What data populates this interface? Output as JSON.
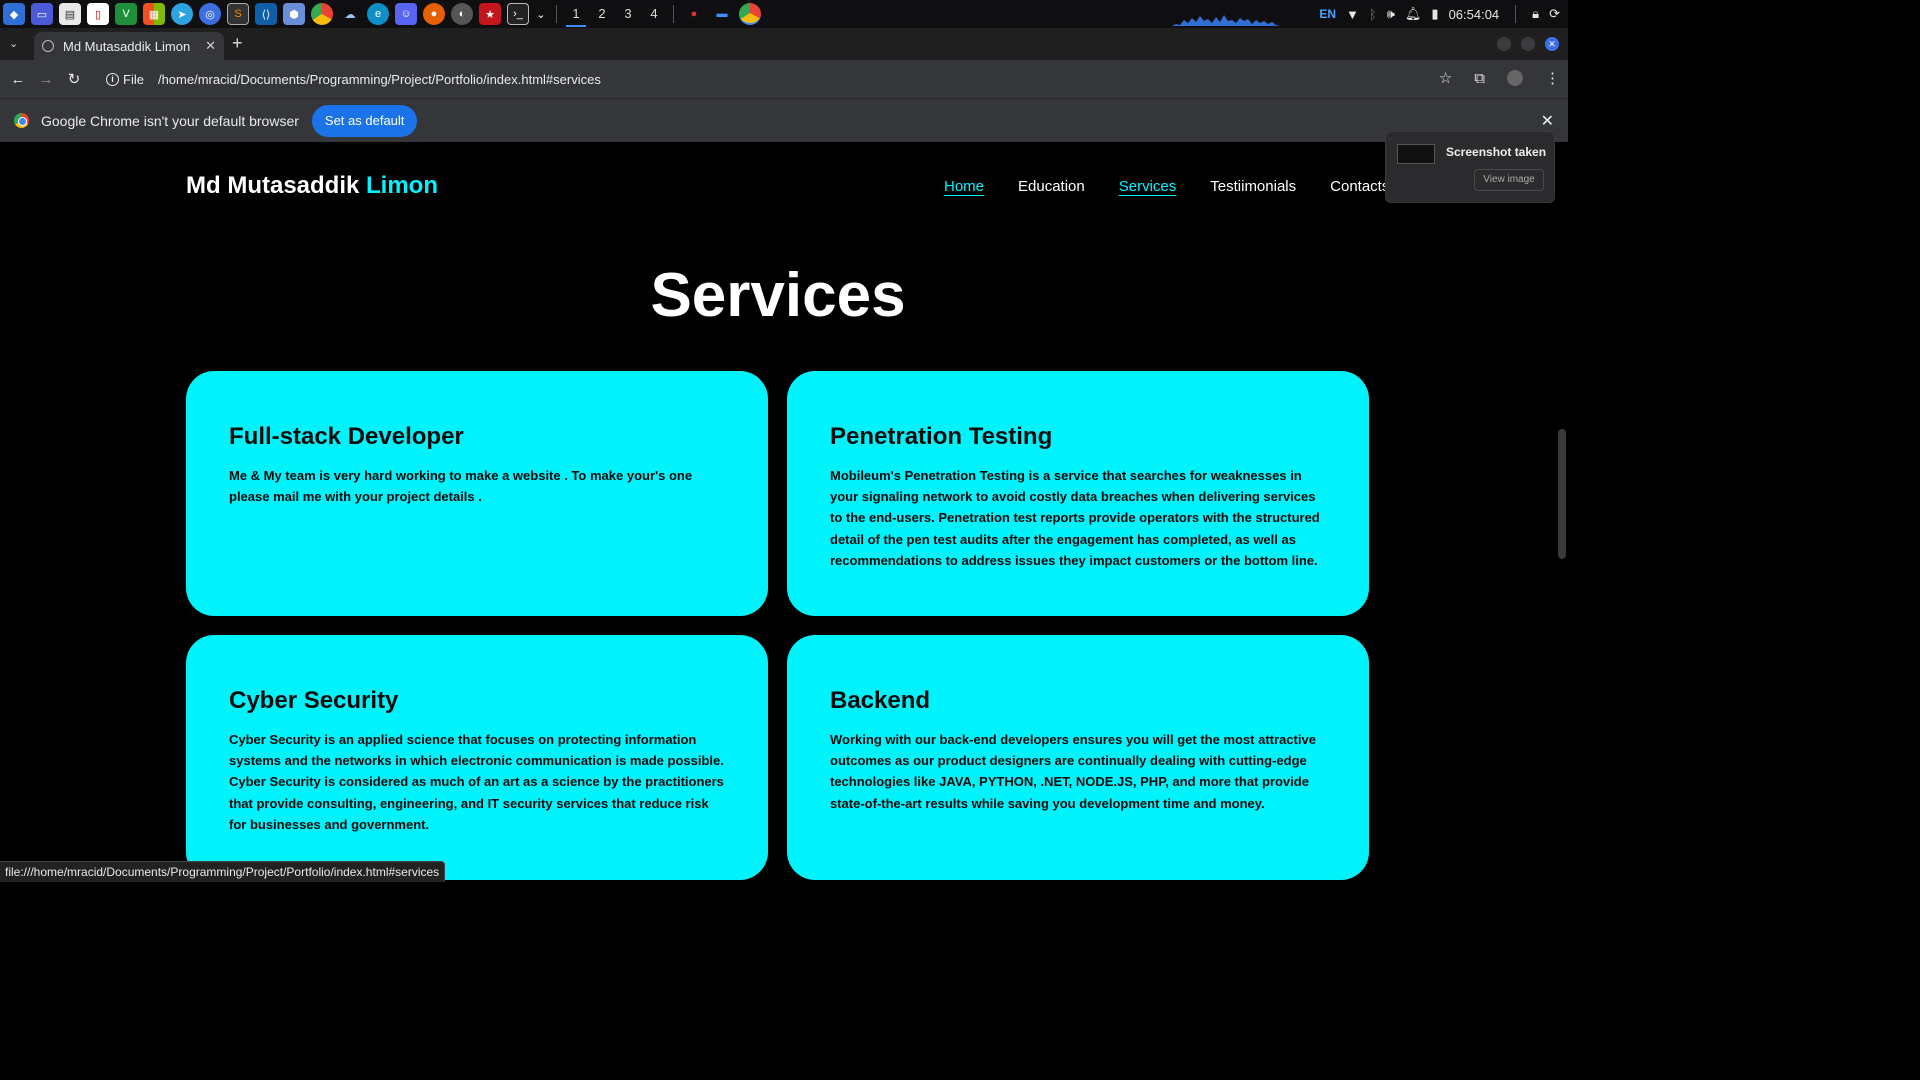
{
  "taskbar": {
    "workspaces": [
      "1",
      "2",
      "3",
      "4"
    ],
    "active_workspace": "1",
    "language": "EN",
    "clock": "06:54:04",
    "apps": [
      "start-menu-icon",
      "desktop-icon",
      "files-icon",
      "pdf-icon",
      "vim-icon",
      "apps-grid-icon",
      "telegram-icon",
      "browser-icon",
      "sublime-icon",
      "vscode-icon",
      "package-icon",
      "chrome-icon",
      "cloud-icon",
      "edge-icon",
      "discord-icon",
      "firefox-icon",
      "github-icon",
      "red-app-icon",
      "terminal-icon"
    ]
  },
  "browser": {
    "tab_title": "Md Mutasaddik Limon",
    "scheme_label": "File",
    "url": "/home/mracid/Documents/Programming/Project/Portfolio/index.html#services",
    "infobar_text": "Google Chrome isn't your default browser",
    "set_default_label": "Set as default",
    "status_url": "file:///home/mracid/Documents/Programming/Project/Portfolio/index.html#services"
  },
  "toast": {
    "title": "Screenshot taken",
    "button": "View image"
  },
  "site": {
    "logo_first": "Md Mutasaddik ",
    "logo_accent": "Limon",
    "nav": [
      {
        "label": "Home",
        "active": true
      },
      {
        "label": "Education",
        "active": false
      },
      {
        "label": "Services",
        "active": true
      },
      {
        "label": "Testiimonials",
        "active": false
      },
      {
        "label": "Contacts",
        "active": false
      }
    ],
    "section_title": "Services",
    "cards": [
      {
        "title": "Full-stack Developer",
        "text": "Me & My team is very hard working to make a website . To make your's one please mail me with your project details ."
      },
      {
        "title": "Penetration Testing",
        "text": "Mobileum's Penetration Testing is a service that searches for weaknesses in your signaling network to avoid costly data breaches when delivering services to the end-users. Penetration test reports provide operators with the structured detail of the pen test audits after the engagement has completed, as well as recommendations to address issues they impact customers or the bottom line."
      },
      {
        "title": "Cyber Security",
        "text": "Cyber Security is an applied science that focuses on protecting information systems and the networks in which electronic communication is made possible. Cyber Security is considered as much of an art as a science by the practitioners that provide consulting, engineering, and IT security services that reduce risk for businesses and government."
      },
      {
        "title": "Backend",
        "text": "Working with our back-end developers ensures you will get the most attractive outcomes as our product designers are continually dealing with cutting-edge technologies like JAVA, PYTHON, .NET, NODE.JS, PHP, and more that provide state-of-the-art results while saving you development time and money."
      }
    ]
  },
  "colors": {
    "accent": "#00f3ff",
    "card_bg": "#00f3fb",
    "page_bg": "#000000",
    "chrome_blue": "#1a73e8"
  }
}
